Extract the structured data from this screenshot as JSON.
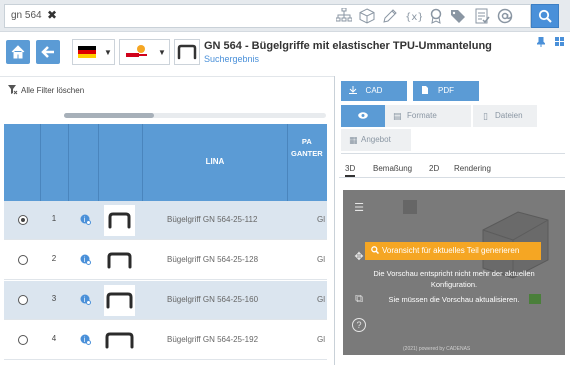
{
  "search": {
    "query": "gn 564",
    "clear_symbol": "✖",
    "tool_icons": [
      "sitemap-icon",
      "cube-icon",
      "pencil-icon",
      "variable-icon",
      "certificate-icon",
      "tags-icon",
      "checklist-icon",
      "at-icon"
    ],
    "search_symbol": "⚲"
  },
  "header": {
    "home_symbol": "⌂",
    "back_symbol": "←",
    "title": "GN 564 - Bügelgriffe mit elastischer TPU-Ummantelung",
    "subtitle": "Suchergebnis",
    "pin_symbol": "▮",
    "grid_symbol": "▦"
  },
  "left_panel": {
    "filter_clear_label": "Alle Filter löschen",
    "columns": [
      {
        "key": "select",
        "label": ""
      },
      {
        "key": "num",
        "label": ""
      },
      {
        "key": "info",
        "label": ""
      },
      {
        "key": "image",
        "label": ""
      },
      {
        "key": "lina",
        "label": "LINA"
      },
      {
        "key": "pa",
        "label": "PA\nGANTER"
      }
    ],
    "col_pa_label_line1": "PA",
    "col_pa_label_line2": "GANTER",
    "col_lina_label": "LINA",
    "rows": [
      {
        "num": "1",
        "name": "Bügelgriff GN 564-25-112",
        "trunc": "Gl",
        "selected": true
      },
      {
        "num": "2",
        "name": "Bügelgriff GN 564-25-128",
        "trunc": "Gl",
        "selected": false
      },
      {
        "num": "3",
        "name": "Bügelgriff GN 564-25-160",
        "trunc": "Gl",
        "selected": false
      },
      {
        "num": "4",
        "name": "Bügelgriff GN 564-25-192",
        "trunc": "Gl",
        "selected": false
      }
    ]
  },
  "right_panel": {
    "cad_label": "CAD",
    "pdf_label": "PDF",
    "tabs": {
      "eye_symbol": "👁",
      "formats_label": "Formate",
      "files_label": "Dateien",
      "offer_label": "Angebot"
    },
    "view_tabs": [
      "3D",
      "Bemaßung",
      "2D",
      "Rendering"
    ],
    "active_view_tab": "3D",
    "viewer": {
      "generate_label": "Voransicht für aktuelles Teil generieren",
      "notice_line1": "Die Vorschau entspricht nicht mehr der aktuellen",
      "notice_line2": "Konfiguration.",
      "notice_line3": "Sie müssen die Vorschau aktualisieren.",
      "watermark": "(2021) powered by CADENAS",
      "tools": [
        "list-icon",
        "move-icon",
        "layers-icon",
        "help-icon"
      ],
      "tool_symbols": {
        "list": "☰",
        "move": "✥",
        "layers": "⧉",
        "help": "?"
      }
    }
  }
}
